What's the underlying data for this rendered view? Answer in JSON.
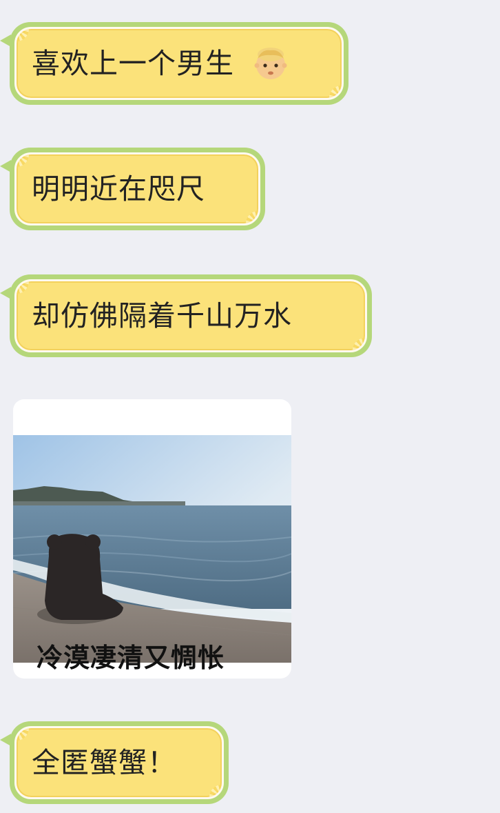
{
  "chat": {
    "messages": [
      {
        "text": "喜欢上一个男生",
        "emoji": "boy-face-emoji"
      },
      {
        "text": "明明近在咫尺"
      },
      {
        "text": "却仿佛隔着千山万水"
      },
      {
        "image": "bear-sitting-by-sea-photo",
        "caption": "冷漠凄清又惆怅"
      },
      {
        "text": "全匿蟹蟹！"
      }
    ]
  },
  "colors": {
    "background": "#eeeff4",
    "bubble_border": "#b5d77a",
    "bubble_fill": "#fbe27a",
    "text": "#222222"
  }
}
